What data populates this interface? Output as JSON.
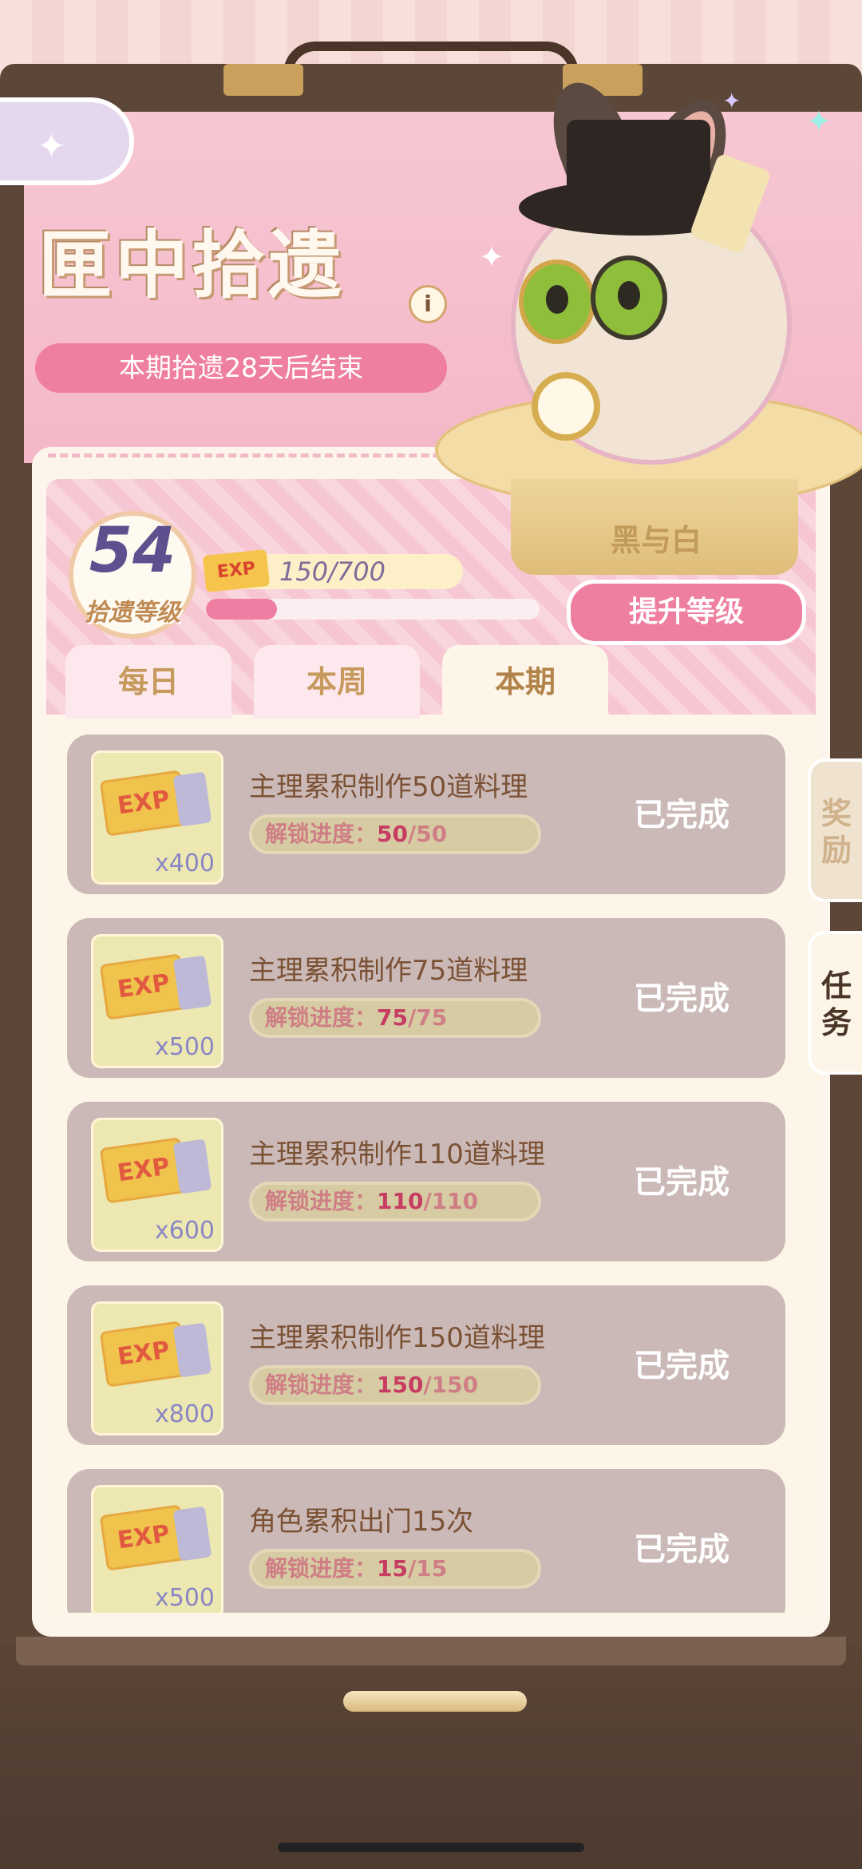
{
  "header": {
    "title": "匣中拾遗",
    "info_icon": "info-icon",
    "period_text": "本期拾遗28天后结束",
    "back_icon": "back-arrow-icon"
  },
  "character": {
    "name": "黑与白"
  },
  "level": {
    "value": "54",
    "label": "拾遗等级",
    "exp_icon_text": "EXP",
    "exp_text": "150/700",
    "exp_fraction": 0.214,
    "levelup_label": "提升等级"
  },
  "tabs": [
    {
      "label": "每日",
      "active": false
    },
    {
      "label": "本周",
      "active": false
    },
    {
      "label": "本期",
      "active": true
    }
  ],
  "side_tabs": [
    {
      "label": "奖励",
      "active": false
    },
    {
      "label": "任务",
      "active": true
    }
  ],
  "tasks": [
    {
      "title": "主理累积制作50道料理",
      "progress_label": "解锁进度：",
      "progress_current": "50",
      "progress_total": "/50",
      "reward_qty": "x400",
      "status": "已完成"
    },
    {
      "title": "主理累积制作75道料理",
      "progress_label": "解锁进度：",
      "progress_current": "75",
      "progress_total": "/75",
      "reward_qty": "x500",
      "status": "已完成"
    },
    {
      "title": "主理累积制作110道料理",
      "progress_label": "解锁进度：",
      "progress_current": "110",
      "progress_total": "/110",
      "reward_qty": "x600",
      "status": "已完成"
    },
    {
      "title": "主理累积制作150道料理",
      "progress_label": "解锁进度：",
      "progress_current": "150",
      "progress_total": "/150",
      "reward_qty": "x800",
      "status": "已完成"
    },
    {
      "title": "角色累积出门15次",
      "progress_label": "解锁进度：",
      "progress_current": "15",
      "progress_total": "/15",
      "reward_qty": "x500",
      "status": "已完成"
    }
  ],
  "colors": {
    "accent_pink": "#ef7fa0",
    "card_bg": "#cbb9b7",
    "title_brown": "#7a5134"
  }
}
